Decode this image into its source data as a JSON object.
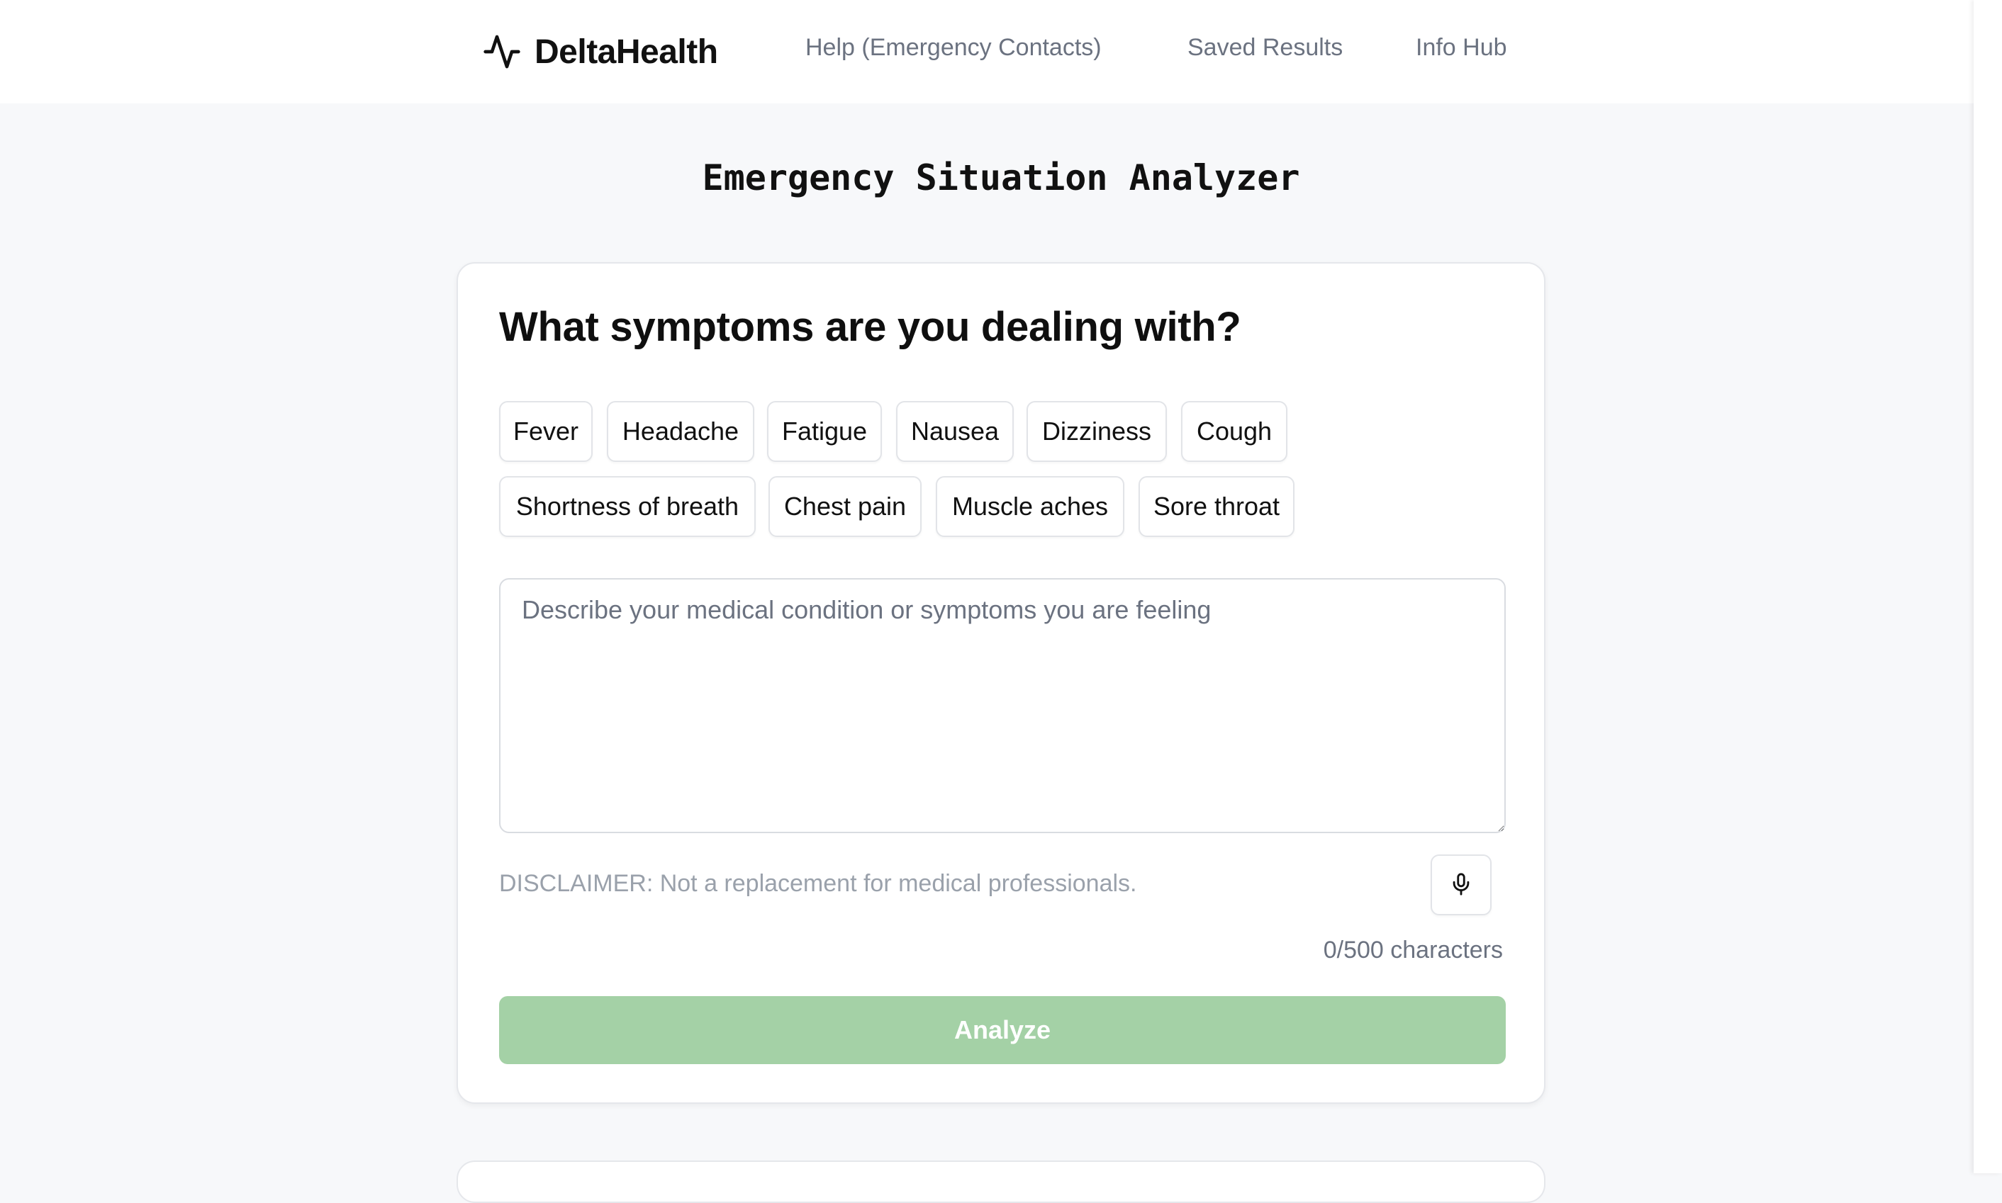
{
  "header": {
    "brand_name": "DeltaHealth",
    "logo_icon": "pulse-icon",
    "nav": {
      "help": "Help (Emergency Contacts)",
      "saved": "Saved Results",
      "info": "Info Hub"
    }
  },
  "page": {
    "title": "Emergency Situation Analyzer"
  },
  "form": {
    "heading": "What symptoms are you dealing with?",
    "symptom_chips": {
      "fever": "Fever",
      "headache": "Headache",
      "fatigue": "Fatigue",
      "nausea": "Nausea",
      "dizziness": "Dizziness",
      "cough": "Cough",
      "shortness_of_breath": "Shortness of breath",
      "chest_pain": "Chest pain",
      "muscle_aches": "Muscle aches",
      "sore_throat": "Sore throat"
    },
    "description_placeholder": "Describe your medical condition or symptoms you are feeling",
    "description_value": "",
    "disclaimer": "DISCLAIMER: Not a replacement for medical professionals.",
    "mic_icon": "microphone-icon",
    "char_count": "0/500 characters",
    "analyze_label": "Analyze"
  },
  "colors": {
    "page_background": "#f7f8fa",
    "analyze_button_disabled": "#a4d1a6",
    "muted_text": "#6b7280",
    "disclaimer_text": "#9aa1ab"
  }
}
